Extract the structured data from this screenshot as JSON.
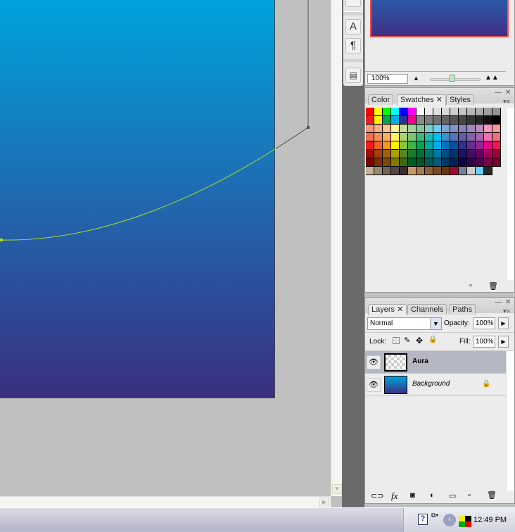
{
  "navigator": {
    "zoom_value": "100%"
  },
  "swatches_panel": {
    "tabs": [
      "Color",
      "Swatches",
      "Styles"
    ],
    "active_tab": "Swatches",
    "colors": [
      [
        "#ff0000",
        "#ffff00",
        "#00ff00",
        "#00ffff",
        "#0000ff",
        "#ff00ff",
        "#ffffff",
        "#ebebeb",
        "#e1e1e1",
        "#d7d7d7",
        "#cccccc",
        "#c2c2c2",
        "#b7b7b7",
        "#acacac",
        "#a0a0a0",
        "#959595"
      ],
      [
        "#ed1c24",
        "#fff200",
        "#00a651",
        "#00aeef",
        "#2e3192",
        "#ec008c",
        "#898989",
        "#7d7d7d",
        "#707070",
        "#646464",
        "#555555",
        "#464646",
        "#363636",
        "#262626",
        "#111111",
        "#000000"
      ],
      [
        "#f7977a",
        "#f9ad81",
        "#fdc68a",
        "#fff79a",
        "#c4df9b",
        "#a3d39c",
        "#82ca9d",
        "#7bcdc8",
        "#6ecff6",
        "#7ea7d8",
        "#8493ca",
        "#8882be",
        "#a187be",
        "#bc8dbf",
        "#f49ac2",
        "#f6989d"
      ],
      [
        "#f26c4f",
        "#f68e55",
        "#fbaf5c",
        "#fff467",
        "#acd372",
        "#7cc576",
        "#3bb878",
        "#1abbb4",
        "#00bff3",
        "#438cca",
        "#5574b9",
        "#605ca8",
        "#855fa8",
        "#a763a8",
        "#f06ea9",
        "#f26d7d"
      ],
      [
        "#ed1c24",
        "#f26522",
        "#f7941d",
        "#fff200",
        "#8dc73f",
        "#39b54a",
        "#00a651",
        "#00a99d",
        "#00aeef",
        "#0072bc",
        "#0054a6",
        "#2e3192",
        "#662d91",
        "#92278f",
        "#ec008c",
        "#ed145b"
      ],
      [
        "#9e0b0f",
        "#a0410d",
        "#a36209",
        "#aba000",
        "#598527",
        "#1a7b30",
        "#007236",
        "#00746b",
        "#0076a3",
        "#004b80",
        "#003471",
        "#1b1464",
        "#440e62",
        "#630460",
        "#9e005d",
        "#9e0039"
      ],
      [
        "#790000",
        "#7b2e00",
        "#7d4900",
        "#827b00",
        "#406618",
        "#005e20",
        "#005826",
        "#005952",
        "#005b7f",
        "#003663",
        "#002157",
        "#0d004c",
        "#32004b",
        "#4b0049",
        "#7b0046",
        "#7a0026"
      ],
      [
        "#c7b299",
        "#998675",
        "#736357",
        "#534741",
        "#37302d",
        "#c69c6d",
        "#a67c52",
        "#8c6239",
        "#754c24",
        "#603913",
        "#9e0b2e",
        "#7d7f9a",
        "#cccccc",
        "#6dcff6",
        "#262626"
      ]
    ]
  },
  "layers_panel": {
    "tabs": [
      "Layers",
      "Channels",
      "Paths"
    ],
    "active_tab": "Layers",
    "blend_mode": "Normal",
    "opacity_label": "Opacity:",
    "opacity": "100%",
    "lock_label": "Lock:",
    "fill_label": "Fill:",
    "fill": "100%",
    "layers": [
      {
        "name": "Aura",
        "selected": true,
        "visible": true
      },
      {
        "name": "Background",
        "selected": false,
        "visible": true,
        "locked": true
      }
    ]
  },
  "taskbar": {
    "clock": "12:49 PM"
  },
  "colors": {
    "gradient_top": "#00a3de",
    "gradient_bottom": "#3a2f80",
    "path_color": "#a8e020",
    "selection_bg": "#b4b6c2"
  }
}
